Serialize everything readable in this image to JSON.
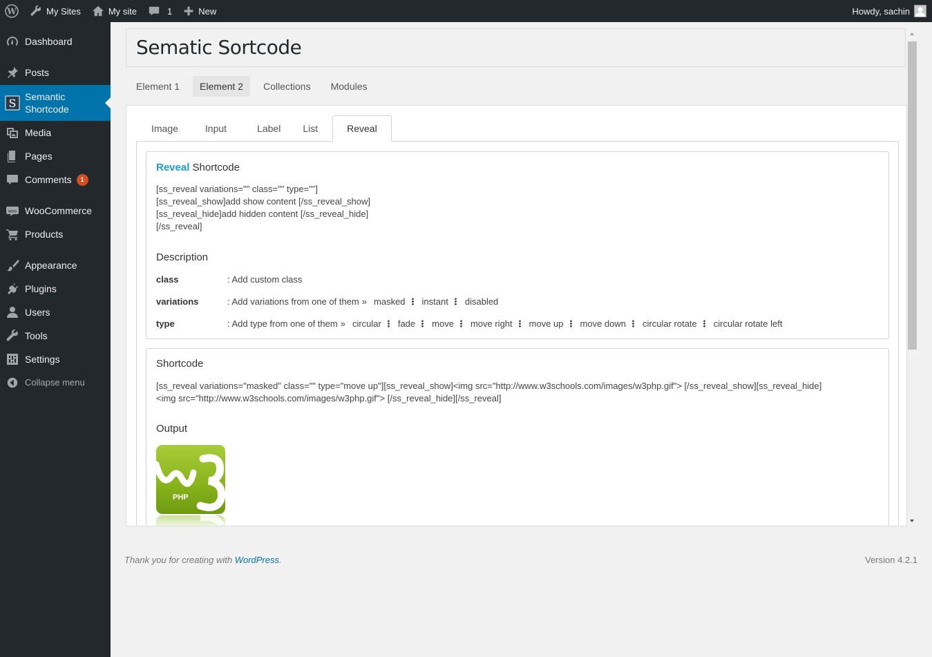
{
  "adminbar": {
    "my_sites": "My Sites",
    "my_site": "My site",
    "comments_count": "1",
    "new_label": "New",
    "howdy": "Howdy, sachin"
  },
  "sidebar": {
    "items": [
      {
        "label": "Dashboard",
        "icon": "dashboard-icon"
      },
      {
        "label": "Posts",
        "icon": "pushpin-icon"
      },
      {
        "label": "Semantic Shortcode",
        "icon": "semantic-shortcode-icon"
      },
      {
        "label": "Media",
        "icon": "media-icon"
      },
      {
        "label": "Pages",
        "icon": "pages-icon"
      },
      {
        "label": "Comments",
        "icon": "comment-icon",
        "badge": "1"
      },
      {
        "label": "WooCommerce",
        "icon": "woocommerce-icon"
      },
      {
        "label": "Products",
        "icon": "cart-icon"
      },
      {
        "label": "Appearance",
        "icon": "paintbrush-icon"
      },
      {
        "label": "Plugins",
        "icon": "plugin-icon"
      },
      {
        "label": "Users",
        "icon": "user-icon"
      },
      {
        "label": "Tools",
        "icon": "wrench-icon"
      },
      {
        "label": "Settings",
        "icon": "settings-icon"
      }
    ],
    "collapse": "Collapse menu"
  },
  "page": {
    "title": "Sematic Sortcode"
  },
  "top_tabs": [
    "Element 1",
    "Element 2",
    "Collections",
    "Modules"
  ],
  "sub_tabs": [
    "Image",
    "Input",
    "Label",
    "List",
    "Reveal"
  ],
  "reveal_card": {
    "title_accent": "Reveal",
    "title_rest": " Shortcode",
    "code_lines": [
      "[ss_reveal variations=\"\" class=\"\" type=\"\"]",
      "[ss_reveal_show]add show content [/ss_reveal_show]",
      "[ss_reveal_hide]add hidden content [/ss_reveal_hide]",
      "[/ss_reveal]"
    ],
    "description_heading": "Description",
    "class_key": "class",
    "class_val": ": Add custom class",
    "variations_key": "variations",
    "variations_val": ": Add variations from one of them",
    "variations_options": [
      "masked",
      "instant",
      "disabled"
    ],
    "type_key": "type",
    "type_val": ": Add type from one of them",
    "type_options": [
      "circular",
      "fade",
      "move",
      "move right",
      "move up",
      "move down",
      "circular rotate",
      "circular rotate left"
    ]
  },
  "shortcode_card": {
    "heading": "Shortcode",
    "line1": "[ss_reveal variations=\"masked\" class=\"\" type=\"move up\"][ss_reveal_show]<img src=\"http://www.w3schools.com/images/w3php.gif\"> [/ss_reveal_show][ss_reveal_hide]",
    "line2": "<img src=\"http://www.w3schools.com/images/w3php.gif\"> [/ss_reveal_hide][/ss_reveal]",
    "output_heading": "Output",
    "logo_text": "PHP"
  },
  "footer": {
    "thanks": "Thank you for creating with ",
    "link": "WordPress",
    "period": ".",
    "version": "Version 4.2.1"
  }
}
